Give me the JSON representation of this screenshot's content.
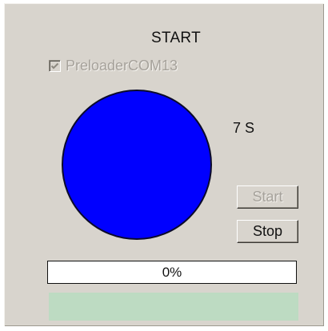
{
  "window": {
    "title": "START"
  },
  "preloader": {
    "label": "PreloaderCOM13",
    "checked": true,
    "enabled": false
  },
  "indicator": {
    "color": "#0000ff"
  },
  "countdown": {
    "text": "7 S"
  },
  "buttons": {
    "start_label": "Start",
    "start_enabled": false,
    "stop_label": "Stop",
    "stop_enabled": true
  },
  "progress": {
    "text": "0%",
    "value": 0
  },
  "status_bar": {
    "color": "#bddbc2"
  },
  "colors": {
    "panel": "#d8d4cd",
    "disabled_text": "#a6a29b"
  },
  "icons": {
    "checkbox": "checkmark-icon"
  }
}
